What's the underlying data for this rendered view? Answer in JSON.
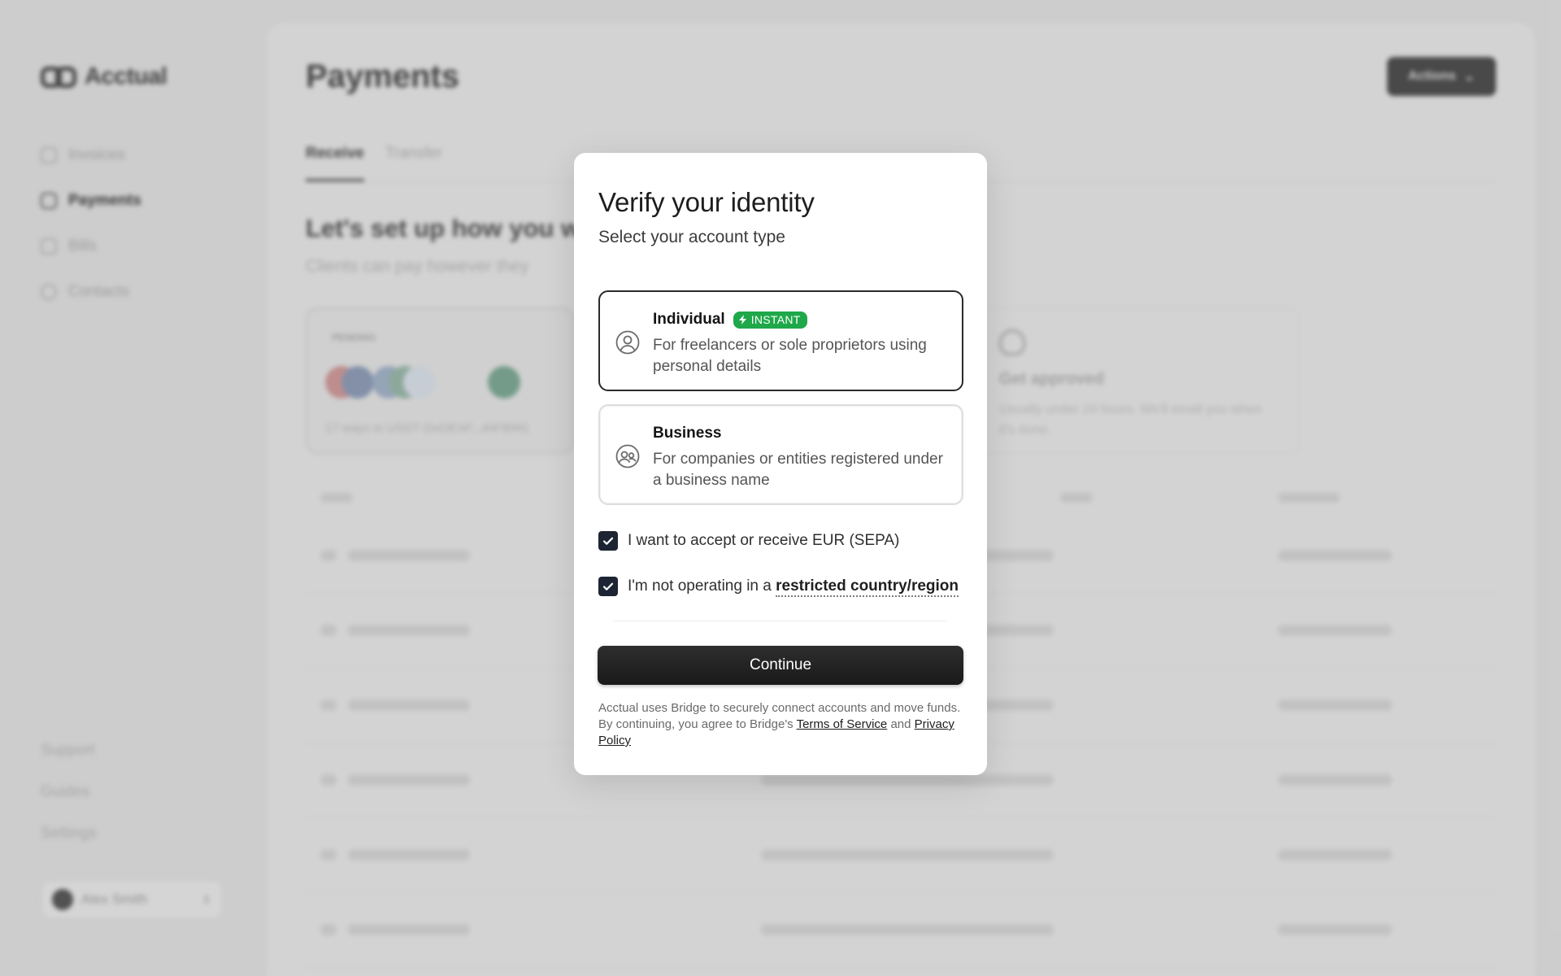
{
  "app": {
    "logo_text": "Acctual",
    "nav": [
      {
        "label": "Invoices",
        "icon": "invoice-icon",
        "active": false
      },
      {
        "label": "Payments",
        "icon": "payments-icon",
        "active": true
      },
      {
        "label": "Bills",
        "icon": "bills-icon",
        "active": false
      },
      {
        "label": "Contacts",
        "icon": "contacts-icon",
        "active": false
      }
    ],
    "footer_links": [
      "Support",
      "Guides",
      "Settings"
    ],
    "user_name": "Alex Smith"
  },
  "main": {
    "title": "Payments",
    "actions_label": "Actions",
    "tabs": [
      {
        "label": "Receive",
        "active": true
      },
      {
        "label": "Transfer",
        "active": false
      }
    ],
    "setup_heading": "Let's set up how you w",
    "setup_sub": "Clients can pay however they",
    "pending_card": {
      "tag": "PENDING",
      "ways_text": "17 ways to USDT (0xDEAF...d4FB96)"
    },
    "approve_card": {
      "title": "Get approved",
      "desc": "Usually under 24 hours. We'll email you when it's done."
    }
  },
  "modal": {
    "title": "Verify your identity",
    "subtitle": "Select your account type",
    "options": [
      {
        "title": "Individual",
        "badge": "INSTANT",
        "desc": "For freelancers or sole proprietors using personal details",
        "icon": "user-circle-icon",
        "selected": true
      },
      {
        "title": "Business",
        "desc": "For companies or entities registered under a business name",
        "icon": "users-circle-icon",
        "selected": false
      }
    ],
    "checkboxes": [
      {
        "label": "I want to accept or receive EUR (SEPA)",
        "checked": true
      },
      {
        "label_prefix": "I'm not operating in a ",
        "link": "restricted country/region",
        "checked": true
      }
    ],
    "continue_label": "Continue",
    "legal": {
      "text": "Acctual uses Bridge to securely connect accounts and move funds. By continuing, you agree to Bridge's ",
      "terms": "Terms of Service",
      "and": " and ",
      "privacy": "Privacy Policy"
    }
  },
  "colors": {
    "badge_green": "#1fa84a",
    "checkbox_navy": "#1d2534",
    "button_dark": "#1a1a1a"
  }
}
